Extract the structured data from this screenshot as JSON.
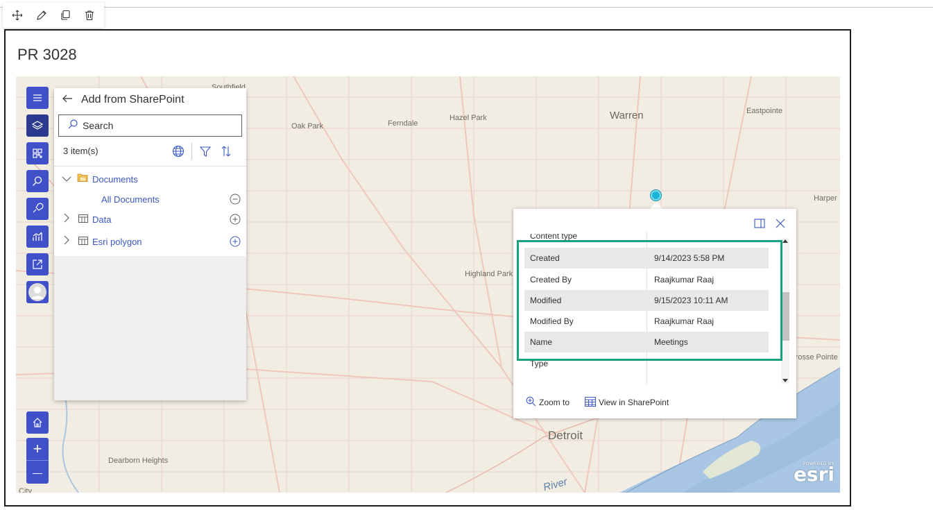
{
  "toolbar": {
    "items": [
      {
        "name": "move-icon"
      },
      {
        "name": "edit-icon"
      },
      {
        "name": "duplicate-icon"
      },
      {
        "name": "delete-icon"
      }
    ]
  },
  "webpart": {
    "title": "PR 3028"
  },
  "map": {
    "places": [
      {
        "text": "Southfield",
        "cls": ""
      },
      {
        "text": "Oak Park",
        "cls": ""
      },
      {
        "text": "Ferndale",
        "cls": ""
      },
      {
        "text": "Hazel Park",
        "cls": ""
      },
      {
        "text": "Warren",
        "cls": "big"
      },
      {
        "text": "Eastpointe",
        "cls": ""
      },
      {
        "text": "Harper",
        "cls": ""
      },
      {
        "text": "Highland Park",
        "cls": ""
      },
      {
        "text": "Grosse Pointe Pa",
        "cls": ""
      },
      {
        "text": "Detroit",
        "cls": "xl"
      },
      {
        "text": "Dearborn Heights",
        "cls": ""
      },
      {
        "text": "River",
        "cls": "water"
      },
      {
        "text": "City",
        "cls": ""
      }
    ],
    "left_tools": [
      "menu-icon",
      "layers-icon",
      "qr-code-icon",
      "search-icon",
      "map-tools-icon",
      "analytics-icon",
      "share-icon",
      "avatar"
    ],
    "home_icon": "home-icon",
    "zoom_in": "+",
    "zoom_out": "—",
    "attribution": {
      "powered_by": "POWERED BY",
      "logo": "esri"
    }
  },
  "panel": {
    "title": "Add from SharePoint",
    "search_placeholder": "Search",
    "count": "3 item(s)",
    "tree": [
      {
        "label": "Documents",
        "level": 0,
        "expanded": true,
        "type": "folder"
      },
      {
        "label": "All Documents",
        "level": 1,
        "action": "remove"
      },
      {
        "label": "Data",
        "level": 0,
        "expanded": false,
        "type": "list",
        "action": "add"
      },
      {
        "label": "Esri polygon",
        "level": 0,
        "expanded": false,
        "type": "list",
        "action": "add"
      }
    ]
  },
  "popup": {
    "partial_top": "Content type",
    "rows": [
      {
        "key": "Created",
        "value": "9/14/2023 5:58 PM"
      },
      {
        "key": "Created By",
        "value": "Raajkumar Raaj"
      },
      {
        "key": "Modified",
        "value": "9/15/2023 10:11 AM"
      },
      {
        "key": "Modified By",
        "value": "Raajkumar Raaj"
      },
      {
        "key": "Name",
        "value": "Meetings"
      }
    ],
    "partial_bottom": "Type",
    "actions": {
      "zoom": "Zoom to",
      "view": "View in SharePoint"
    },
    "highlight_color": "#1aa07f"
  },
  "colors": {
    "accent": "#4050c8",
    "link": "#3b57c4",
    "pin": "#19b4d6"
  }
}
